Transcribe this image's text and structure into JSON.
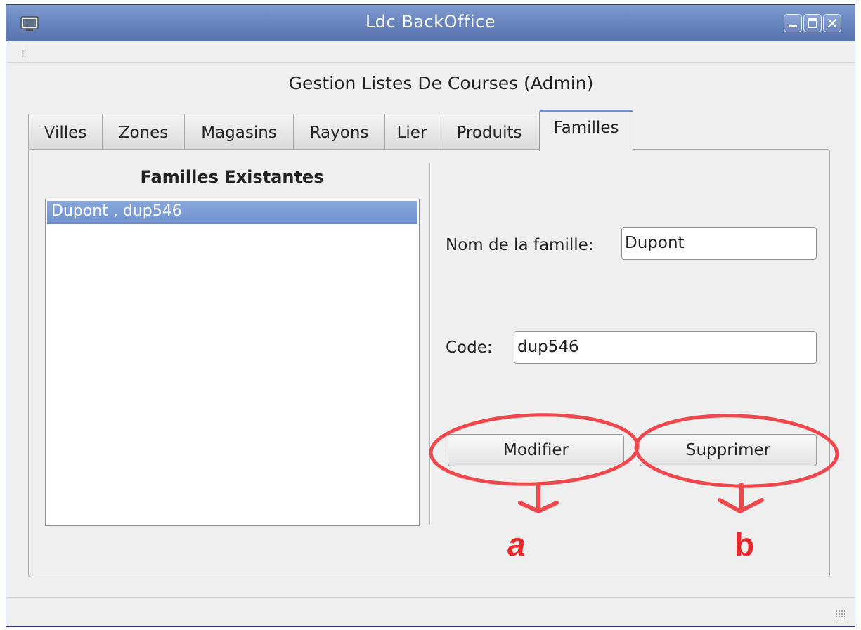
{
  "window": {
    "title": "Ldc BackOffice"
  },
  "heading": "Gestion Listes De Courses (Admin)",
  "tabs": [
    {
      "label": "Villes"
    },
    {
      "label": "Zones"
    },
    {
      "label": "Magasins"
    },
    {
      "label": "Rayons"
    },
    {
      "label": "Lier"
    },
    {
      "label": "Produits"
    },
    {
      "label": "Familles",
      "active": true
    }
  ],
  "families": {
    "list_title": "Familles Existantes",
    "items": [
      "Dupont , dup546"
    ],
    "selected_index": 0
  },
  "form": {
    "name_label": "Nom de la famille:",
    "name_value": "Dupont",
    "code_label": "Code:",
    "code_value": "dup546",
    "modify_label": "Modifier",
    "delete_label": "Supprimer"
  },
  "annotations": {
    "a": "a",
    "b": "b",
    "color": "#e8262c"
  },
  "colors": {
    "titlebar": "#6b87c0",
    "selection": "#7c9bd4",
    "active_tab_accent": "#6c8fd0"
  },
  "icons": [
    "app-icon",
    "minimize-icon",
    "maximize-icon",
    "close-icon",
    "grip-icon",
    "resize-grip-icon"
  ]
}
